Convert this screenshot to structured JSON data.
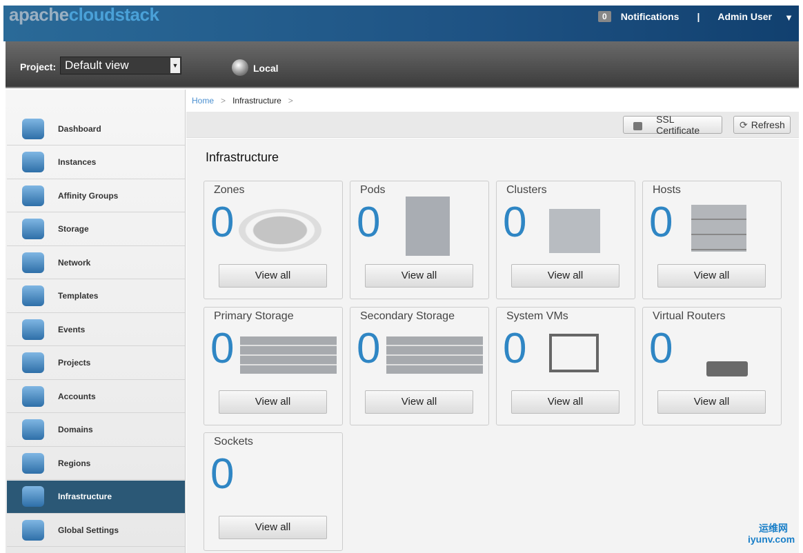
{
  "header": {
    "logo": "apachecloudstack",
    "logo_a": "apache",
    "logo_b": "cloudstack",
    "notification_count": "0",
    "notifications_label": "Notifications",
    "separator": "|",
    "user": "Admin User"
  },
  "project_bar": {
    "label": "Project:",
    "selected": "Default view",
    "zone": "Local"
  },
  "sidebar": {
    "items": [
      {
        "label": "Dashboard"
      },
      {
        "label": "Instances"
      },
      {
        "label": "Affinity Groups"
      },
      {
        "label": "Storage"
      },
      {
        "label": "Network"
      },
      {
        "label": "Templates"
      },
      {
        "label": "Events"
      },
      {
        "label": "Projects"
      },
      {
        "label": "Accounts"
      },
      {
        "label": "Domains"
      },
      {
        "label": "Regions"
      },
      {
        "label": "Infrastructure",
        "active": true
      },
      {
        "label": "Global Settings"
      }
    ]
  },
  "breadcrumb": {
    "home": "Home",
    "sep": ">",
    "current": "Infrastructure"
  },
  "toolbar": {
    "ssl": "SSL Certificate",
    "refresh": "Refresh"
  },
  "page_title": "Infrastructure",
  "cards": [
    {
      "title": "Zones",
      "count": "0",
      "button": "View all"
    },
    {
      "title": "Pods",
      "count": "0",
      "button": "View all"
    },
    {
      "title": "Clusters",
      "count": "0",
      "button": "View all"
    },
    {
      "title": "Hosts",
      "count": "0",
      "button": "View all"
    },
    {
      "title": "Primary Storage",
      "count": "0",
      "button": "View all"
    },
    {
      "title": "Secondary Storage",
      "count": "0",
      "button": "View all"
    },
    {
      "title": "System VMs",
      "count": "0",
      "button": "View all"
    },
    {
      "title": "Virtual Routers",
      "count": "0",
      "button": "View all"
    },
    {
      "title": "Sockets",
      "count": "0",
      "button": "View all"
    }
  ],
  "watermark": {
    "line1": "运维网",
    "line2": "iyunv.com"
  }
}
